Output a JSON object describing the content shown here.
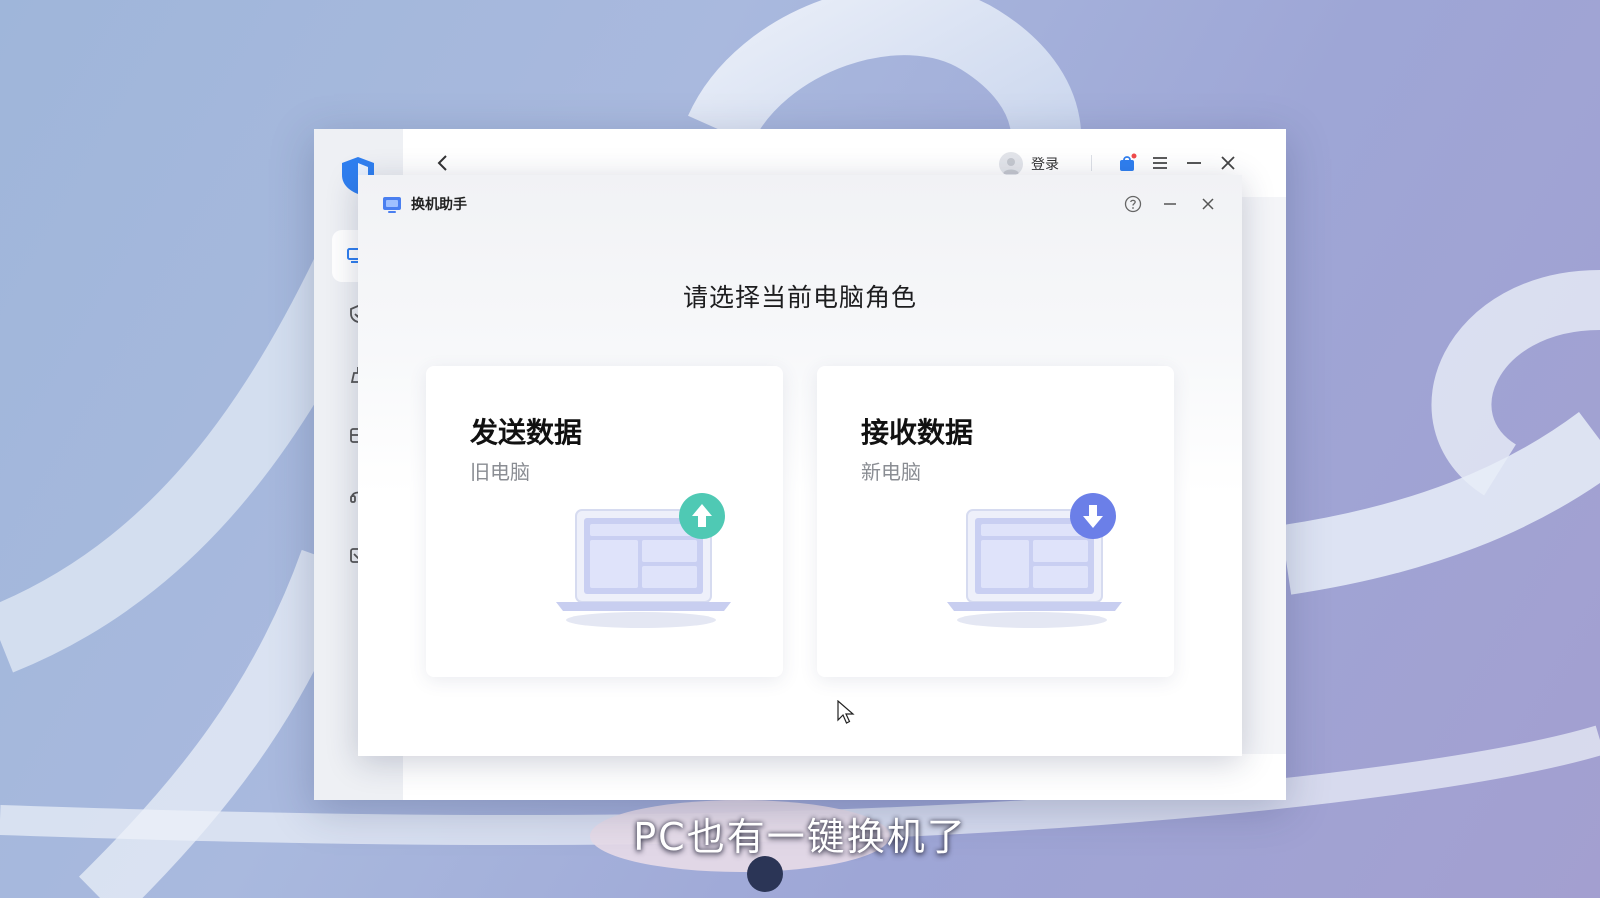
{
  "app": {
    "login_label": "登录"
  },
  "dialog": {
    "title": "换机助手",
    "heading": "请选择当前电脑角色",
    "cards": [
      {
        "title": "发送数据",
        "subtitle": "旧电脑",
        "badge_icon": "upload-arrow-icon",
        "badge_color": "#4fc9b4"
      },
      {
        "title": "接收数据",
        "subtitle": "新电脑",
        "badge_icon": "download-arrow-icon",
        "badge_color": "#6b7fe8"
      }
    ]
  },
  "video_caption": "PC也有一键换机了",
  "colors": {
    "accent": "#2f7ff0",
    "notification_dot": "#f04a4a"
  }
}
